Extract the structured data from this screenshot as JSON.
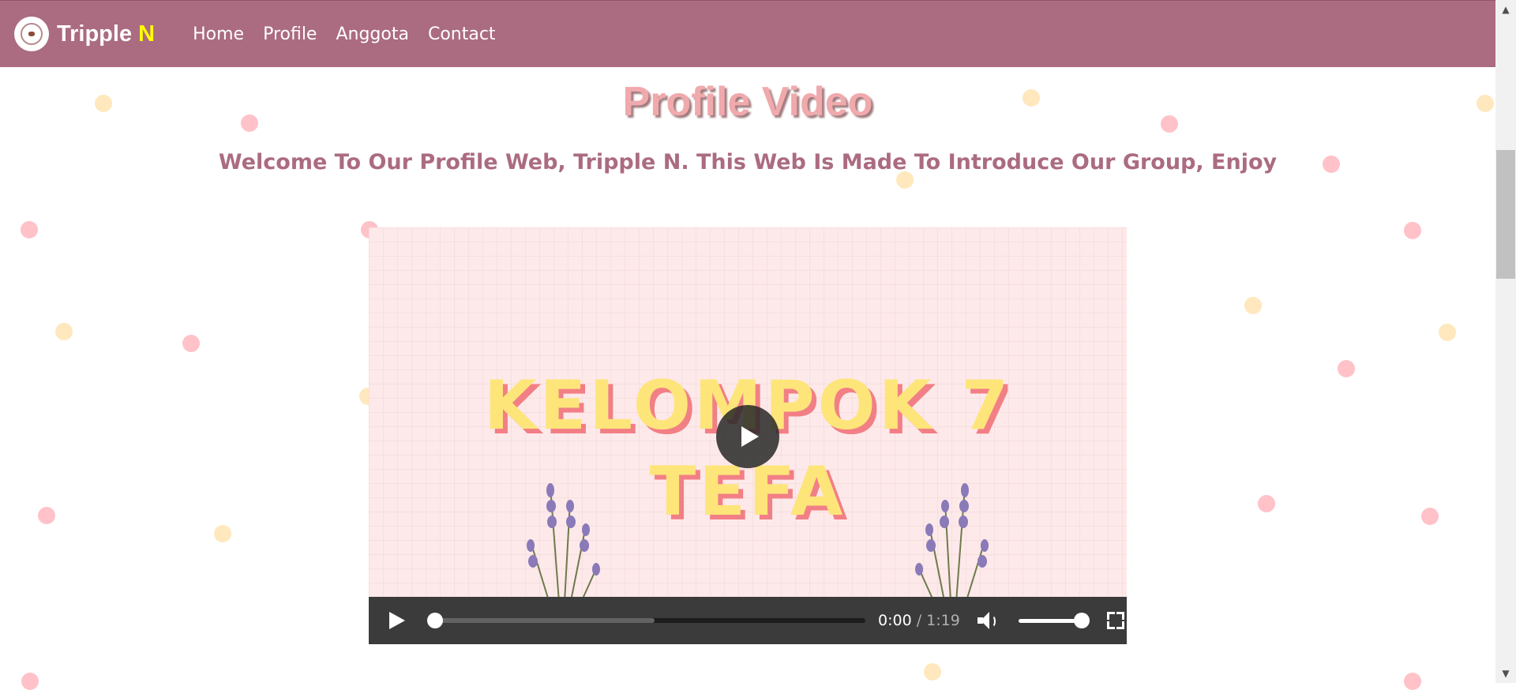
{
  "navbar": {
    "brand_main": "Tripple ",
    "brand_accent": "N",
    "links": [
      "Home",
      "Profile",
      "Anggota",
      "Contact"
    ],
    "background_color": "#ab6b80",
    "accent_color": "#ffff00"
  },
  "page": {
    "title": "Profile Video",
    "subtitle": "Welcome To Our Profile Web, Tripple N. This Web Is Made To Introduce Our Group, Enjoy"
  },
  "video": {
    "frame_text_line1": "KELOMPOK 7",
    "frame_text_line2": "TEFA",
    "current_time": "0:00",
    "time_separator": "/",
    "duration": "1:19",
    "playback_progress": 0.0,
    "buffered_fraction": 0.51,
    "volume_level": 1.0
  },
  "icons": [
    "logo-icon",
    "big-play-icon",
    "play-icon",
    "volume-icon",
    "fullscreen-icon",
    "scroll-up-arrow-icon",
    "scroll-down-arrow-icon"
  ]
}
